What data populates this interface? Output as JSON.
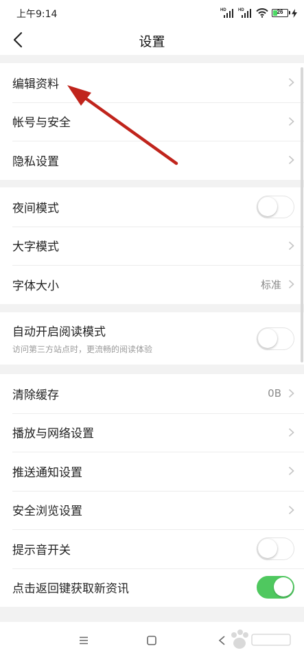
{
  "status_bar": {
    "time": "上午9:14",
    "battery": "26",
    "signal_1": "HD",
    "signal_2": "HD"
  },
  "header": {
    "title": "设置"
  },
  "groups": [
    {
      "items": [
        {
          "label": "编辑资料",
          "type": "chevron"
        },
        {
          "label": "帐号与安全",
          "type": "chevron"
        },
        {
          "label": "隐私设置",
          "type": "chevron"
        }
      ]
    },
    {
      "items": [
        {
          "label": "夜间模式",
          "type": "toggle",
          "on": false
        },
        {
          "label": "大字模式",
          "type": "chevron"
        },
        {
          "label": "字体大小",
          "type": "value",
          "value": "标准"
        }
      ]
    },
    {
      "items": [
        {
          "label": "自动开启阅读模式",
          "sub": "访问第三方站点时，更流畅的阅读体验",
          "type": "toggle",
          "on": false
        }
      ]
    },
    {
      "items": [
        {
          "label": "清除缓存",
          "type": "value",
          "value": "0B"
        },
        {
          "label": "播放与网络设置",
          "type": "chevron"
        },
        {
          "label": "推送通知设置",
          "type": "chevron"
        },
        {
          "label": "安全浏览设置",
          "type": "chevron"
        },
        {
          "label": "提示音开关",
          "type": "toggle",
          "on": false
        },
        {
          "label": "点击返回键获取新资讯",
          "type": "toggle",
          "on": true
        }
      ]
    }
  ],
  "colors": {
    "accent_green": "#4fc85f",
    "annotation_red": "#c0241c",
    "background": "#f2f2f2"
  },
  "icons": {
    "back": "chevron-left-icon",
    "menu": "menu-icon",
    "home": "square-icon",
    "nav_back": "triangle-back-icon",
    "watermark": "baidu-paw-logo"
  }
}
